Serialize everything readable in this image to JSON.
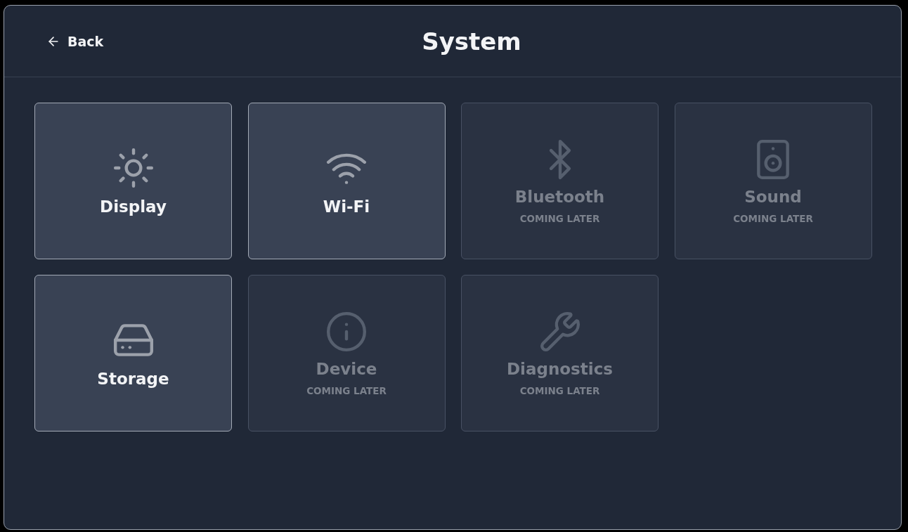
{
  "header": {
    "back_label": "Back",
    "title": "System"
  },
  "cards": [
    {
      "label": "Display",
      "disabled": false
    },
    {
      "label": "Wi-Fi",
      "disabled": false
    },
    {
      "label": "Bluetooth",
      "disabled": true,
      "note": "COMING LATER"
    },
    {
      "label": "Sound",
      "disabled": true,
      "note": "COMING LATER"
    },
    {
      "label": "Storage",
      "disabled": false
    },
    {
      "label": "Device",
      "disabled": true,
      "note": "COMING LATER"
    },
    {
      "label": "Diagnostics",
      "disabled": true,
      "note": "COMING LATER"
    }
  ]
}
